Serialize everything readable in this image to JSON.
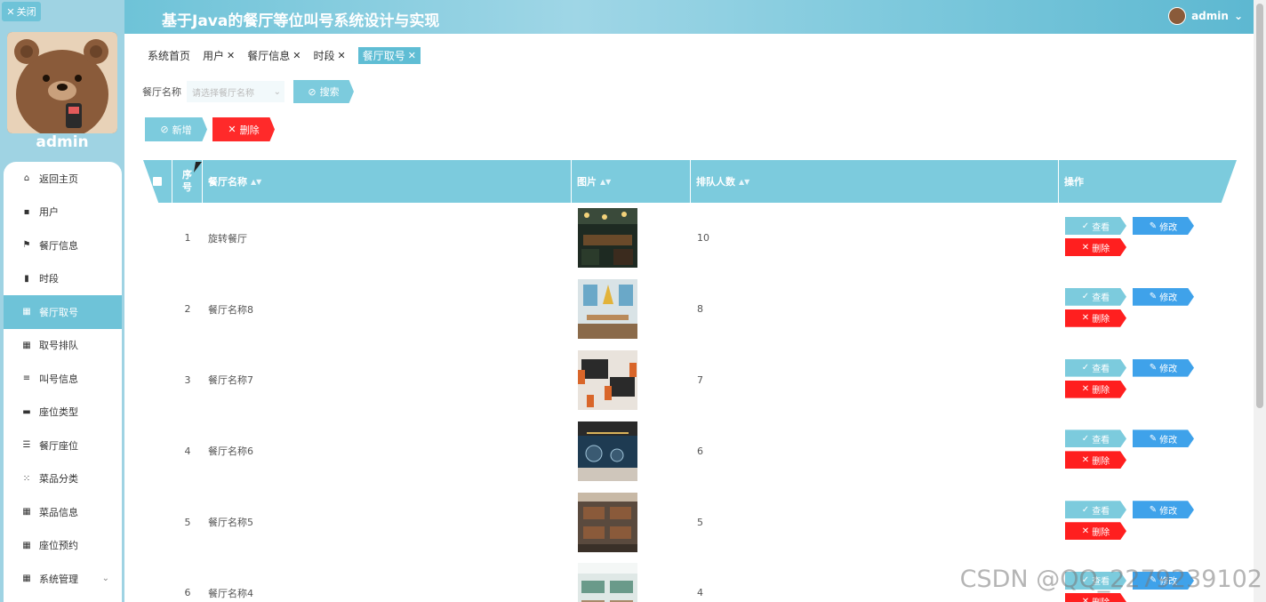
{
  "sidebar": {
    "close_label": "关闭",
    "username": "admin",
    "items": [
      {
        "label": "返回主页",
        "icon": "home-icon",
        "glyph": "⌂"
      },
      {
        "label": "用户",
        "icon": "user-icon",
        "glyph": "▪"
      },
      {
        "label": "餐厅信息",
        "icon": "flag-icon",
        "glyph": "⚑"
      },
      {
        "label": "时段",
        "icon": "chart-icon",
        "glyph": "▮"
      },
      {
        "label": "餐厅取号",
        "icon": "grid-icon",
        "glyph": "▦",
        "active": true
      },
      {
        "label": "取号排队",
        "icon": "grid-icon",
        "glyph": "▦"
      },
      {
        "label": "叫号信息",
        "icon": "list-icon",
        "glyph": "≡"
      },
      {
        "label": "座位类型",
        "icon": "comment-icon",
        "glyph": "▬"
      },
      {
        "label": "餐厅座位",
        "icon": "sliders-icon",
        "glyph": "☰"
      },
      {
        "label": "菜品分类",
        "icon": "apps-icon",
        "glyph": "⁙"
      },
      {
        "label": "菜品信息",
        "icon": "grid-icon",
        "glyph": "▦"
      },
      {
        "label": "座位预约",
        "icon": "grid-icon",
        "glyph": "▦"
      },
      {
        "label": "系统管理",
        "icon": "grid-icon",
        "glyph": "▦",
        "has_submenu": true
      }
    ]
  },
  "header": {
    "title": "基于Java的餐厅等位叫号系统设计与实现",
    "user": "admin"
  },
  "tabs": [
    {
      "label": "系统首页",
      "closable": false
    },
    {
      "label": "用户",
      "closable": true
    },
    {
      "label": "餐厅信息",
      "closable": true
    },
    {
      "label": "时段",
      "closable": true
    },
    {
      "label": "餐厅取号",
      "closable": true,
      "active": true
    }
  ],
  "search": {
    "label": "餐厅名称",
    "placeholder": "请选择餐厅名称",
    "button": "搜索"
  },
  "actions": {
    "add": "新增",
    "delete": "删除"
  },
  "table": {
    "columns": {
      "index": "序号",
      "name": "餐厅名称",
      "image": "图片",
      "queue": "排队人数",
      "ops": "操作"
    },
    "rows": [
      {
        "index": "1",
        "name": "旋转餐厅",
        "queue": "10"
      },
      {
        "index": "2",
        "name": "餐厅名称8",
        "queue": "8"
      },
      {
        "index": "3",
        "name": "餐厅名称7",
        "queue": "7"
      },
      {
        "index": "4",
        "name": "餐厅名称6",
        "queue": "6"
      },
      {
        "index": "5",
        "name": "餐厅名称5",
        "queue": "5"
      },
      {
        "index": "6",
        "name": "餐厅名称4",
        "queue": "4"
      }
    ],
    "row_actions": {
      "view": "查看",
      "edit": "修改",
      "remove": "删除"
    }
  },
  "watermark": "CSDN @QQ_2279239102",
  "colors": {
    "accent": "#7ccbdd",
    "danger": "#ff1f1f",
    "edit": "#3fa2ea"
  }
}
